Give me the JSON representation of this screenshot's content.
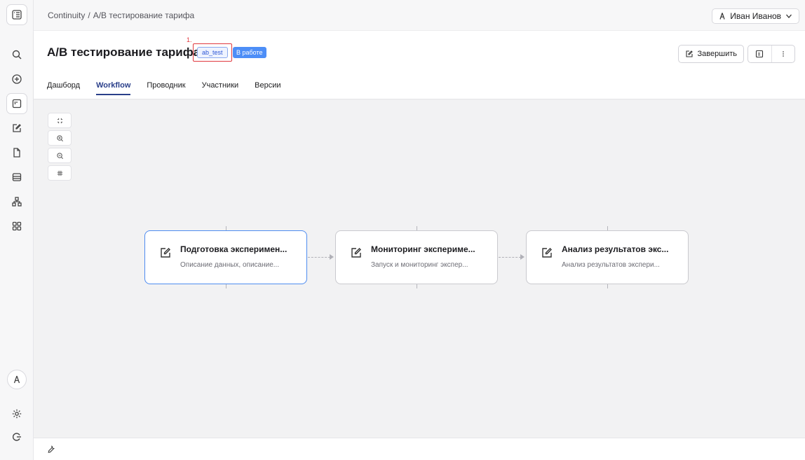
{
  "breadcrumb": {
    "root": "Continuity",
    "separator": "/",
    "current": "А/В тестирование тарифа"
  },
  "user": {
    "name": "Иван Иванов"
  },
  "page": {
    "title": "А/В тестирование тарифа",
    "annotation_number": "1.",
    "tag_code": "ab_test",
    "status": "В работе"
  },
  "actions": {
    "finish_label": "Завершить"
  },
  "tabs": [
    {
      "label": "Дашборд",
      "active": false
    },
    {
      "label": "Workflow",
      "active": true
    },
    {
      "label": "Проводник",
      "active": false
    },
    {
      "label": "Участники",
      "active": false
    },
    {
      "label": "Версии",
      "active": false
    }
  ],
  "workflow": {
    "nodes": [
      {
        "title": "Подготовка эксперимен...",
        "description": "Описание данных, описание...",
        "selected": true
      },
      {
        "title": "Мониторинг экспериме...",
        "description": "Запуск и мониторинг экспер...",
        "selected": false
      },
      {
        "title": "Анализ результатов экс...",
        "description": "Анализ результатов экспери...",
        "selected": false
      }
    ]
  },
  "colors": {
    "accent": "#4e8cf0",
    "status_bg": "#4d8ef7",
    "annotation": "#e0383e",
    "active_tab": "#2a3f8a"
  }
}
